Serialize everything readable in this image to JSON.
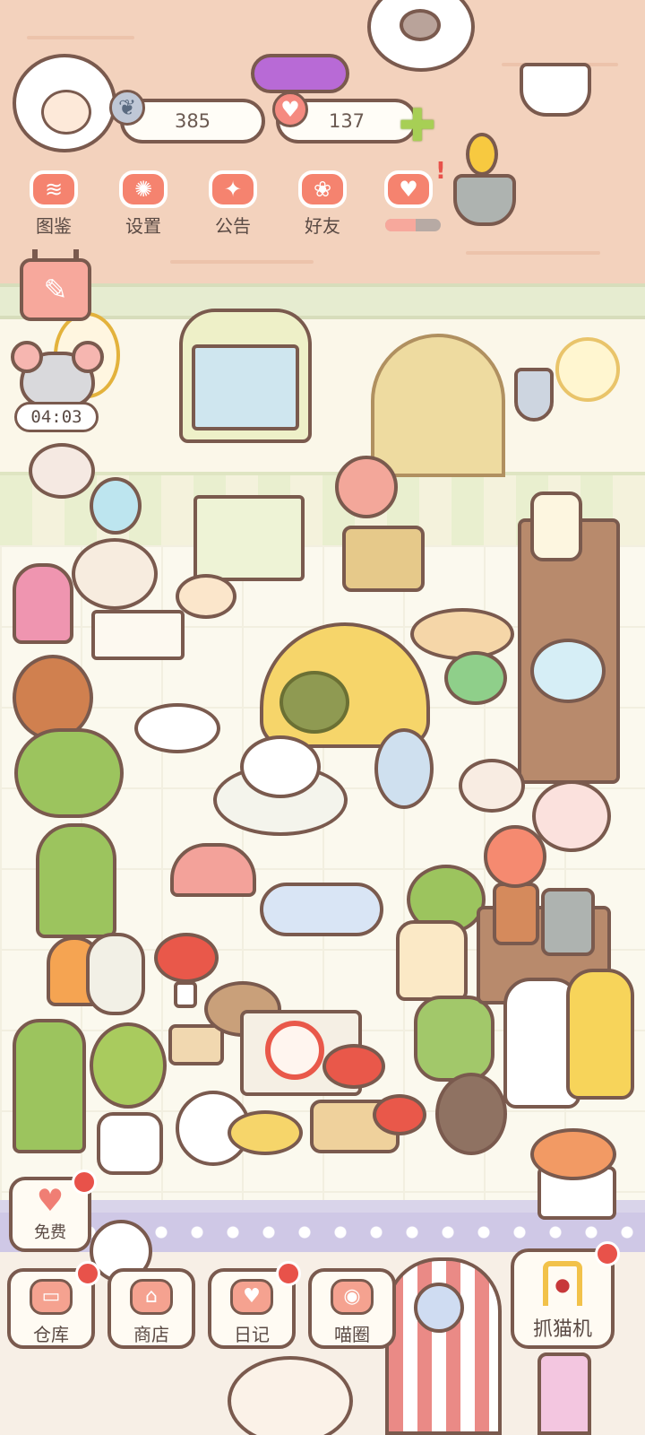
{
  "hud": {
    "fish_currency": "385",
    "heart_currency": "137",
    "timer": "04:03",
    "event_progress": 0.55
  },
  "menu": {
    "guide": "图鉴",
    "settings": "设置",
    "notice": "公告",
    "friends": "好友"
  },
  "side": {
    "free": "免费"
  },
  "nav": {
    "storage": "仓库",
    "shop": "商店",
    "diary": "日记",
    "cat_circle": "喵圈",
    "claw_machine": "抓猫机"
  },
  "icons": {
    "plus": "✚",
    "alert": "!",
    "edit": "✎",
    "fish": "❦",
    "heart": "♥"
  },
  "colors": {
    "accent": "#f5836f",
    "notification_dot": "#e8524a",
    "outline": "#7a5a4e",
    "plus": "#a7cf55"
  }
}
